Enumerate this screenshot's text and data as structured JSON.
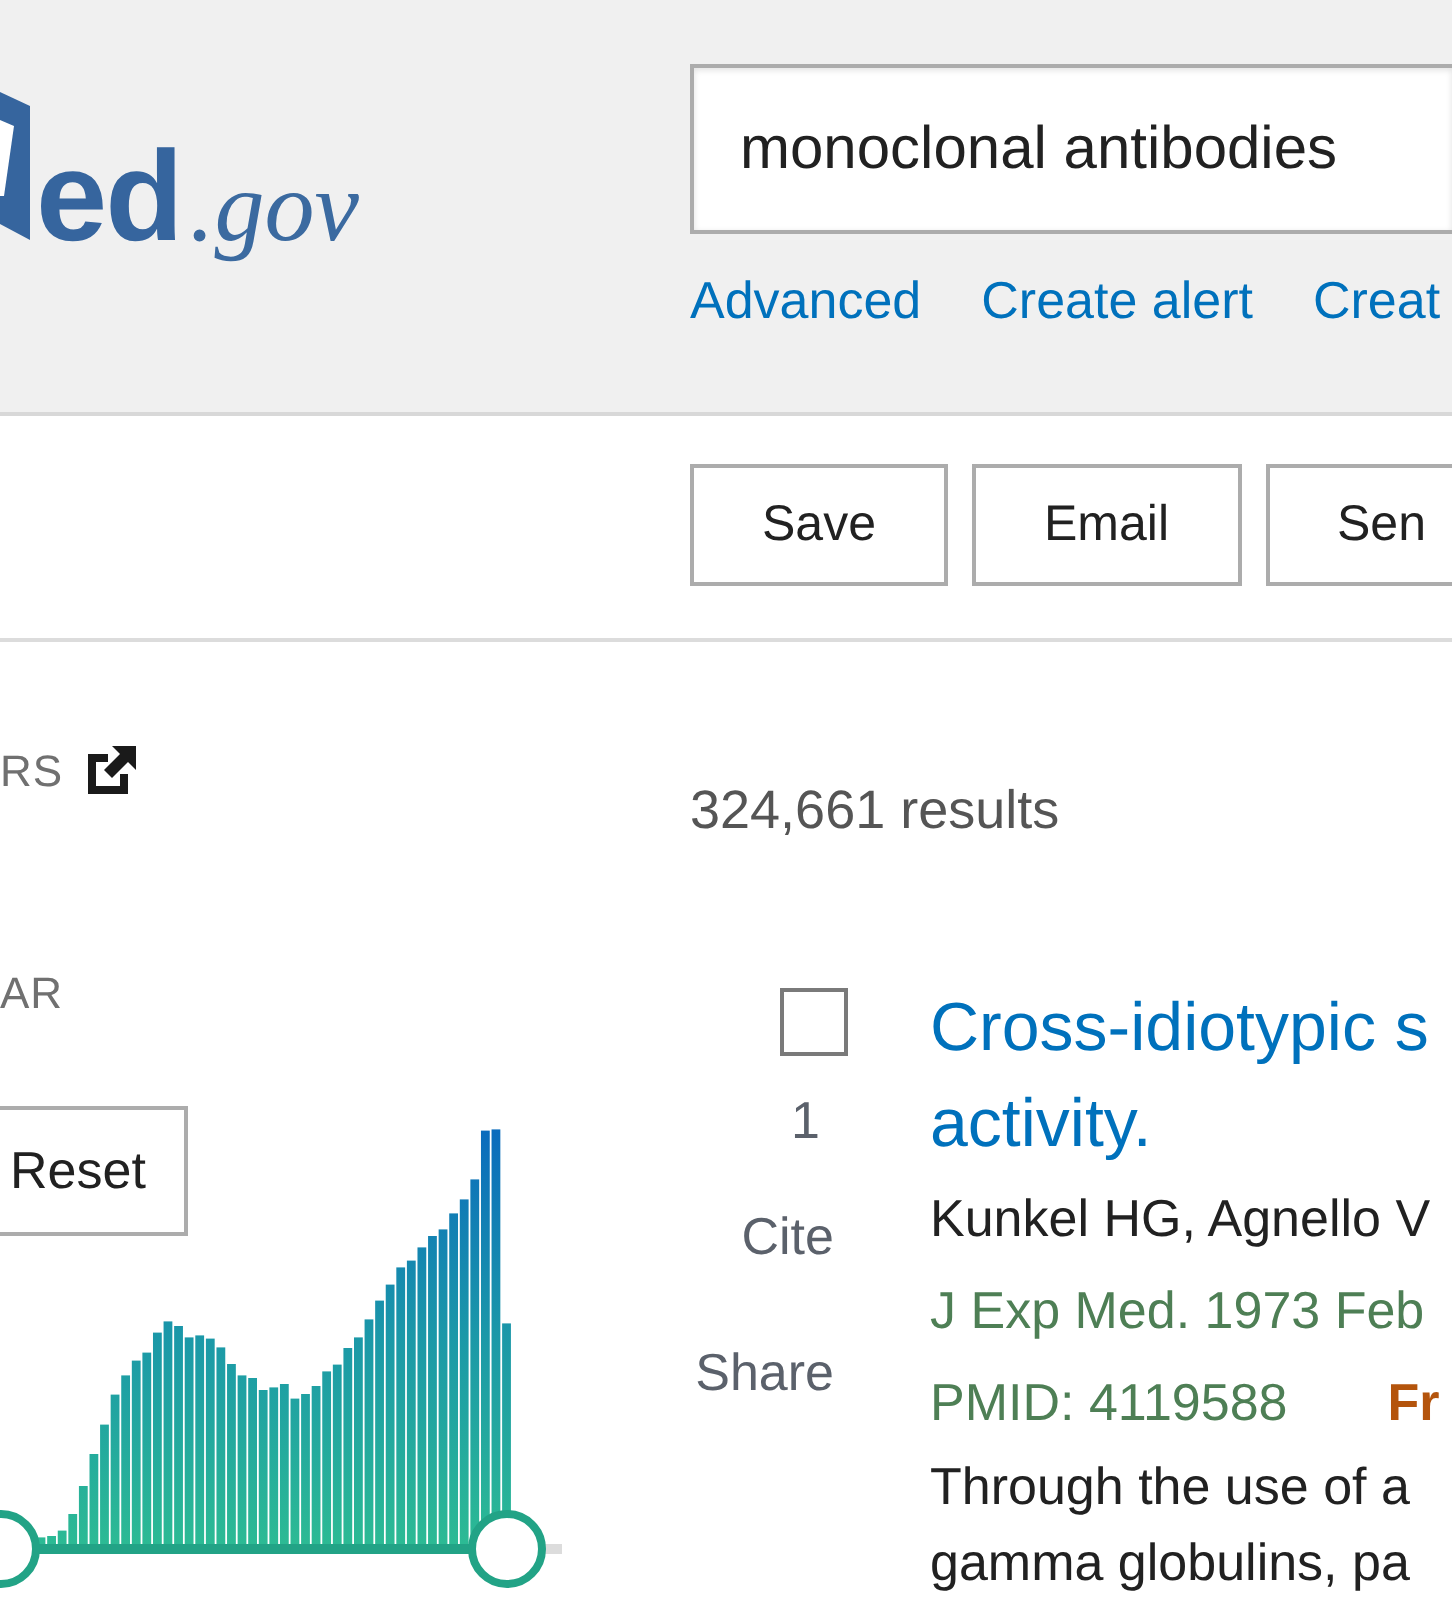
{
  "header": {
    "logo": {
      "wordmark": "ed",
      "domain": ".gov"
    },
    "search": {
      "value": "monoclonal antibodies"
    },
    "links": [
      "Advanced",
      "Create alert",
      "Creat"
    ]
  },
  "toolbar": {
    "buttons": [
      "Save",
      "Email",
      "Sen"
    ]
  },
  "sidebar": {
    "filters_heading": "RS",
    "year_heading": "AR",
    "reset_button": "Reset",
    "year_slider": {
      "handles": [
        {
          "level": 0
        },
        {
          "level": 0.97
        }
      ]
    }
  },
  "results": {
    "count": "324,661 results",
    "items": [
      {
        "checked": false,
        "number": "1",
        "actions": [
          "Cite",
          "Share"
        ],
        "title_lines": [
          "Cross-idiotypic s",
          "activity."
        ],
        "authors": "Kunkel HG, Agnello V",
        "journal": "J Exp Med. 1973 Feb",
        "pmid": "PMID: 4119588",
        "free_label": "Fr",
        "snippet_lines": [
          "Through the use of a",
          "gamma globulins, pa"
        ]
      }
    ]
  }
}
